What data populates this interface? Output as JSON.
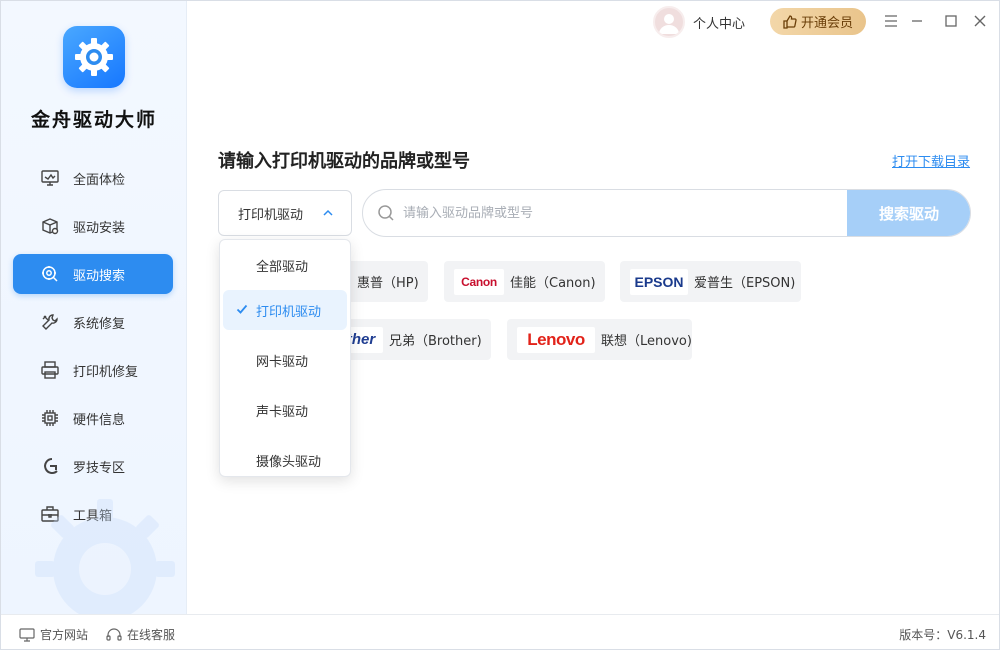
{
  "app": {
    "name": "金舟驱动大师"
  },
  "topbar": {
    "user_center": "个人中心",
    "vip_label": "开通会员"
  },
  "sidebar": {
    "items": [
      {
        "label": "全面体检",
        "icon": "monitor-check-icon"
      },
      {
        "label": "驱动安装",
        "icon": "package-gear-icon"
      },
      {
        "label": "驱动搜索",
        "icon": "search-gear-icon",
        "active": true
      },
      {
        "label": "系统修复",
        "icon": "wrench-icon"
      },
      {
        "label": "打印机修复",
        "icon": "printer-icon"
      },
      {
        "label": "硬件信息",
        "icon": "chip-icon"
      },
      {
        "label": "罗技专区",
        "icon": "logitech-icon"
      },
      {
        "label": "工具箱",
        "icon": "toolbox-icon"
      }
    ]
  },
  "main": {
    "title": "请输入打印机驱动的品牌或型号",
    "download_link": "打开下载目录",
    "type_select": {
      "value": "打印机驱动"
    },
    "search": {
      "placeholder": "请输入驱动品牌或型号",
      "button": "搜索驱动"
    },
    "dropdown": {
      "options": [
        {
          "label": "全部驱动"
        },
        {
          "label": "打印机驱动",
          "selected": true
        },
        {
          "label": "网卡驱动"
        },
        {
          "label": "声卡驱动"
        },
        {
          "label": "摄像头驱动"
        }
      ]
    },
    "brands": [
      {
        "logo": "",
        "label": "惠普（HP)"
      },
      {
        "logo": "Canon",
        "label": "佳能（Canon)"
      },
      {
        "logo": "EPSON",
        "label": "爱普生（EPSON)"
      },
      {
        "logo": "ther",
        "label": "兄弟（Brother)"
      },
      {
        "logo": "Lenovo",
        "label": "联想（Lenovo)"
      }
    ]
  },
  "footer": {
    "official_site": "官方网站",
    "online_service": "在线客服",
    "version": "版本号：V6.1.4"
  },
  "colors": {
    "accent": "#2d8cf0",
    "search_button": "#a6cff8",
    "vip_gold": "#e9c48b",
    "canon_red": "#c8102e",
    "epson_blue": "#1a3a8c",
    "lenovo_red": "#e2231a"
  }
}
